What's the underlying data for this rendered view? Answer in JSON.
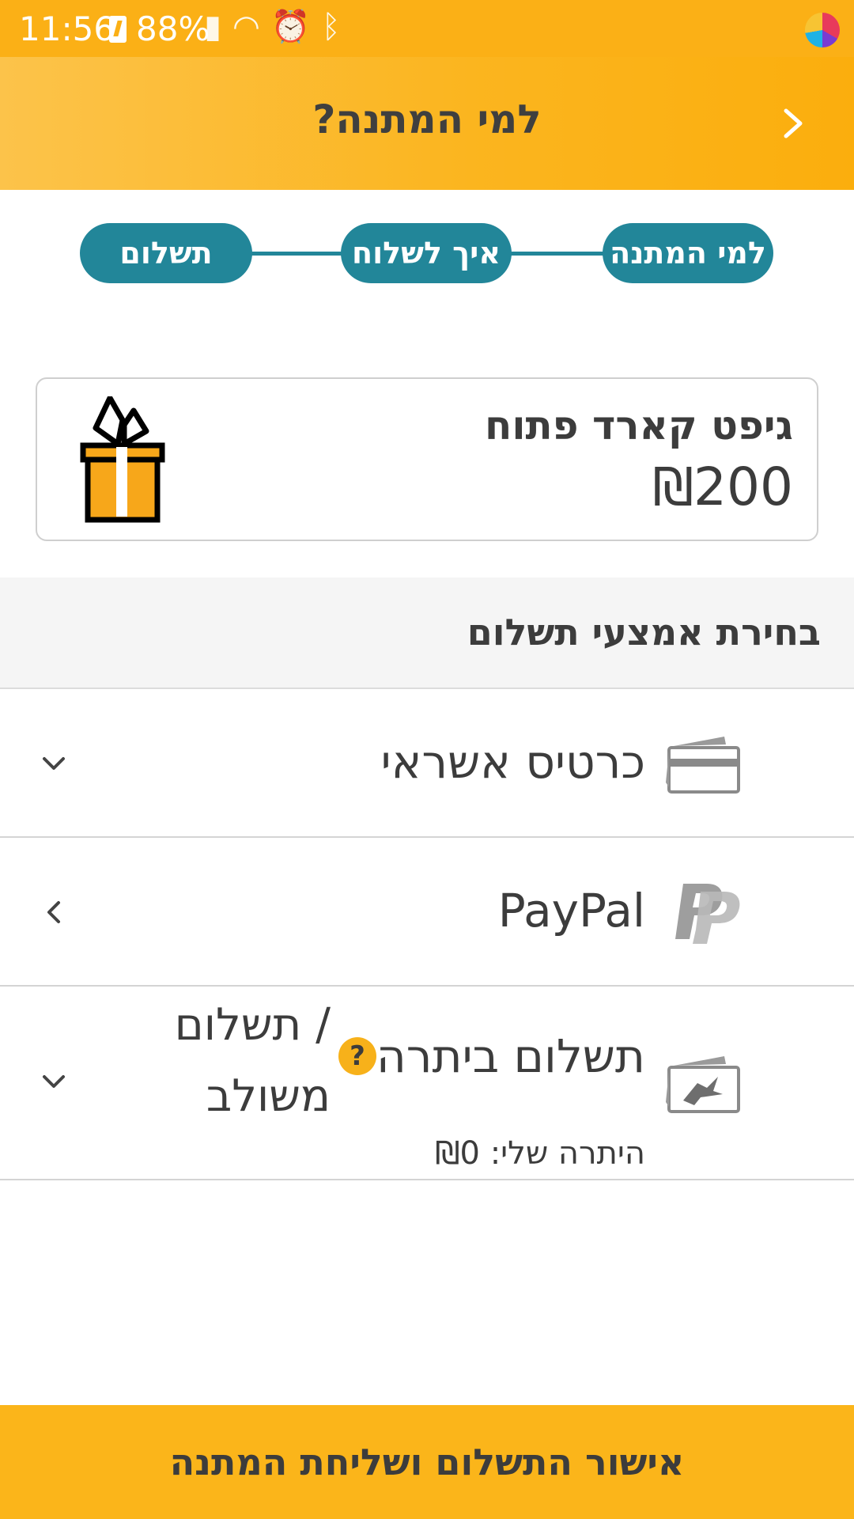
{
  "status_bar": {
    "time": "11:56",
    "battery": "88%",
    "icons": [
      "battery-charging-icon",
      "signal-icon",
      "wifi-icon",
      "alarm-icon",
      "bluetooth-icon",
      "app-icon"
    ]
  },
  "header": {
    "title": "למי המתנה?",
    "back_icon": "chevron-right-icon"
  },
  "stepper": {
    "steps": [
      "למי המתנה",
      "איך לשלוח",
      "תשלום"
    ]
  },
  "gift_card": {
    "name": "גיפט קארד פתוח",
    "amount": "₪200",
    "icon": "gift-box-icon"
  },
  "payment": {
    "section_title": "בחירת אמצעי תשלום",
    "methods": [
      {
        "label": "כרטיס אשראי",
        "icon": "credit-card-icon",
        "chevron": "chevron-down-icon"
      },
      {
        "label": "PayPal",
        "icon": "paypal-icon",
        "chevron": "chevron-left-icon"
      },
      {
        "label": "תשלום ביתרה",
        "combined_label": "/ תשלום משולב",
        "balance_text": "היתרה שלי: ₪0",
        "icon": "balance-card-icon",
        "help_icon": "question-icon",
        "chevron": "chevron-down-icon"
      }
    ]
  },
  "footer": {
    "confirm_label": "אישור התשלום ושליחת המתנה"
  },
  "colors": {
    "brand_yellow": "#fbb016",
    "step_teal": "#228699",
    "text_dark": "#3c3c3c"
  }
}
